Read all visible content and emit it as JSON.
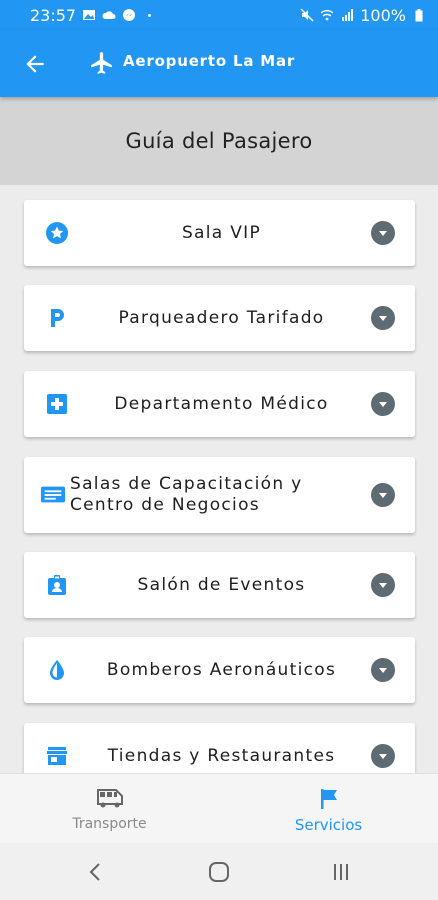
{
  "status_bar": {
    "time": "23:57",
    "battery": "100%"
  },
  "app_bar": {
    "title": "Aeropuerto La Mar"
  },
  "header": {
    "title": "Guía del Pasajero"
  },
  "items": [
    {
      "label": "Sala VIP",
      "icon": "star-circle-icon"
    },
    {
      "label": "Parqueadero Tarifado",
      "icon": "parking-icon"
    },
    {
      "label": "Departamento Médico",
      "icon": "medical-cross-icon"
    },
    {
      "label_line1": "Salas de Capacitación y",
      "label_line2": "Centro de Negocios",
      "icon": "presentation-icon"
    },
    {
      "label": "Salón de Eventos",
      "icon": "badge-icon"
    },
    {
      "label": "Bomberos Aeronáuticos",
      "icon": "water-drop-icon"
    },
    {
      "label": "Tiendas y Restaurantes",
      "icon": "store-icon"
    }
  ],
  "bottom_nav": {
    "transport_label": "Transporte",
    "services_label": "Servicios",
    "active": "services"
  },
  "colors": {
    "primary": "#2196f3",
    "chevron": "#5f6b73",
    "header_bg": "#d4d4d4"
  }
}
